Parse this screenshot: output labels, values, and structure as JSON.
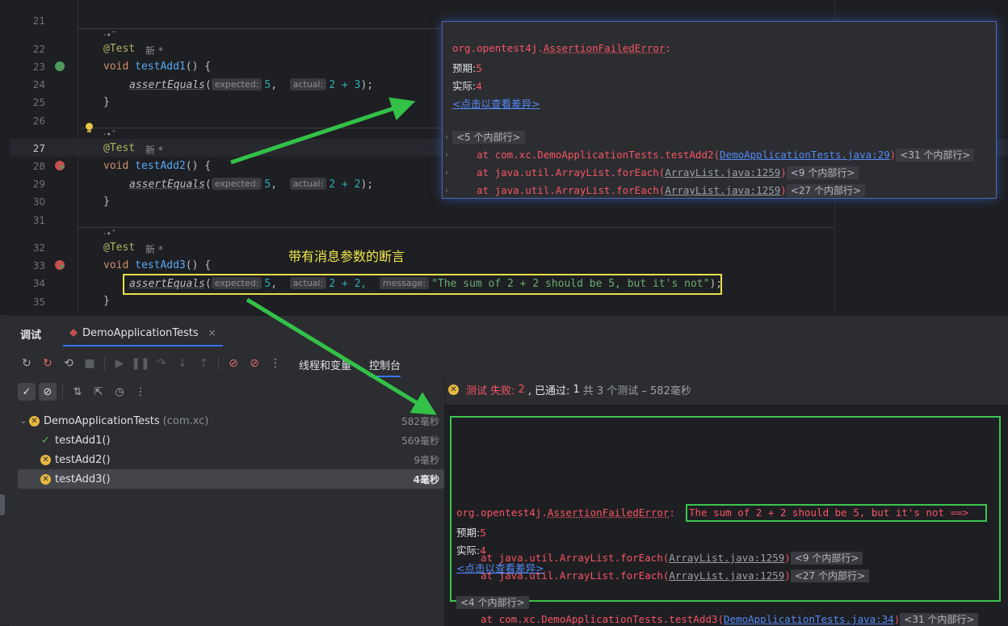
{
  "editor": {
    "line_numbers": [
      "21",
      "22",
      "23",
      "24",
      "25",
      "26",
      "27",
      "28",
      "29",
      "30",
      "31",
      "32",
      "33",
      "34",
      "35"
    ],
    "current_line": "27",
    "meta_label": "·•ˇ",
    "new_mark": "新 *",
    "annotation": "@Test",
    "method1": {
      "kw": "void",
      "name": "testAdd1",
      "sig": "() {",
      "call": "assertEquals",
      "expected_hint": "expected:",
      "expected": "5",
      "actual_hint": "actual:",
      "actual": "2 + 3",
      "end": ");"
    },
    "method2": {
      "kw": "void",
      "name": "testAdd2",
      "sig": "() {",
      "call": "assertEquals",
      "expected_hint": "expected:",
      "expected": "5",
      "actual_hint": "actual:",
      "actual": "2 + 2",
      "end": ");"
    },
    "method3": {
      "kw": "void",
      "name": "testAdd3",
      "sig": "() {",
      "call": "assertEquals",
      "expected_hint": "expected:",
      "expected": "5",
      "actual_hint": "actual:",
      "actual": "2 + 2,",
      "message_hint": "message:",
      "message": "\"The sum of 2 + 2 should be 5, but it's not\"",
      "end": ");"
    },
    "close_brace": "}",
    "annotation_label": "带有消息参数的断言"
  },
  "popup": {
    "error_class": "org.opentest4j.",
    "error_name": "AssertionFailedError",
    "error_colon": ":",
    "expected_label": "预期:",
    "expected_value": "5",
    "actual_label": "实际:",
    "actual_value": "4",
    "diff_link": "<点击以查看差异>",
    "fold_top": "<5 个内部行>",
    "frames": [
      {
        "prefix": "at com.xc.DemoApplicationTests.testAdd2(",
        "link": "DemoApplicationTests.java:29",
        "suffix": ")",
        "fold": "<31 个内部行>"
      },
      {
        "prefix": "at java.util.ArrayList.forEach(",
        "link": "ArrayList.java:1259",
        "suffix": ")",
        "fold": "<9 个内部行>"
      },
      {
        "prefix": "at java.util.ArrayList.forEach(",
        "link": "ArrayList.java:1259",
        "suffix": ")",
        "fold": "<27 个内部行>"
      }
    ]
  },
  "toolwindow": {
    "title": "调试",
    "run_tab": "DemoApplicationTests",
    "close": "×",
    "view_tabs": [
      "线程和变量",
      "控制台"
    ],
    "status": {
      "fail_label": "测试 失败:",
      "fail_count": "2",
      "passed_label": ", 已通过:",
      "passed_count": "1",
      "rest": "共 3 个测试 – 582毫秒"
    },
    "tree": [
      {
        "name": "DemoApplicationTests",
        "pkg": "(com.xc)",
        "time": "582毫秒",
        "status": "fail",
        "level": 0
      },
      {
        "name": "testAdd1()",
        "time": "569毫秒",
        "status": "pass",
        "level": 1
      },
      {
        "name": "testAdd2()",
        "time": "9毫秒",
        "status": "fail",
        "level": 1
      },
      {
        "name": "testAdd3()",
        "time": "4毫秒",
        "status": "fail",
        "level": 1
      }
    ]
  },
  "console": {
    "error_class": "org.opentest4j.",
    "error_name": "AssertionFailedError",
    "error_colon": ":",
    "message": "The sum of 2 + 2 should be 5, but it's not ==>",
    "expected_label": "预期:",
    "expected_value": "5",
    "actual_label": "实际:",
    "actual_value": "4",
    "diff_link": "<点击以查看差异>",
    "fold_top": "<4 个内部行>",
    "frames": [
      {
        "prefix": "at com.xc.DemoApplicationTests.testAdd3(",
        "link": "DemoApplicationTests.java:34",
        "suffix": ")",
        "fold": "<31 个内部行>"
      },
      {
        "prefix": "at java.util.ArrayList.forEach(",
        "link": "ArrayList.java:1259",
        "suffix": ")",
        "fold": "<9 个内部行>"
      },
      {
        "prefix": "at java.util.ArrayList.forEach(",
        "link": "ArrayList.java:1259",
        "suffix": ")",
        "fold": "<27 个内部行>"
      }
    ]
  },
  "colors": {
    "accent": "#3574f0",
    "error": "#f75464",
    "highlight_yellow": "#e8e04a",
    "highlight_green": "#3cc44e"
  }
}
